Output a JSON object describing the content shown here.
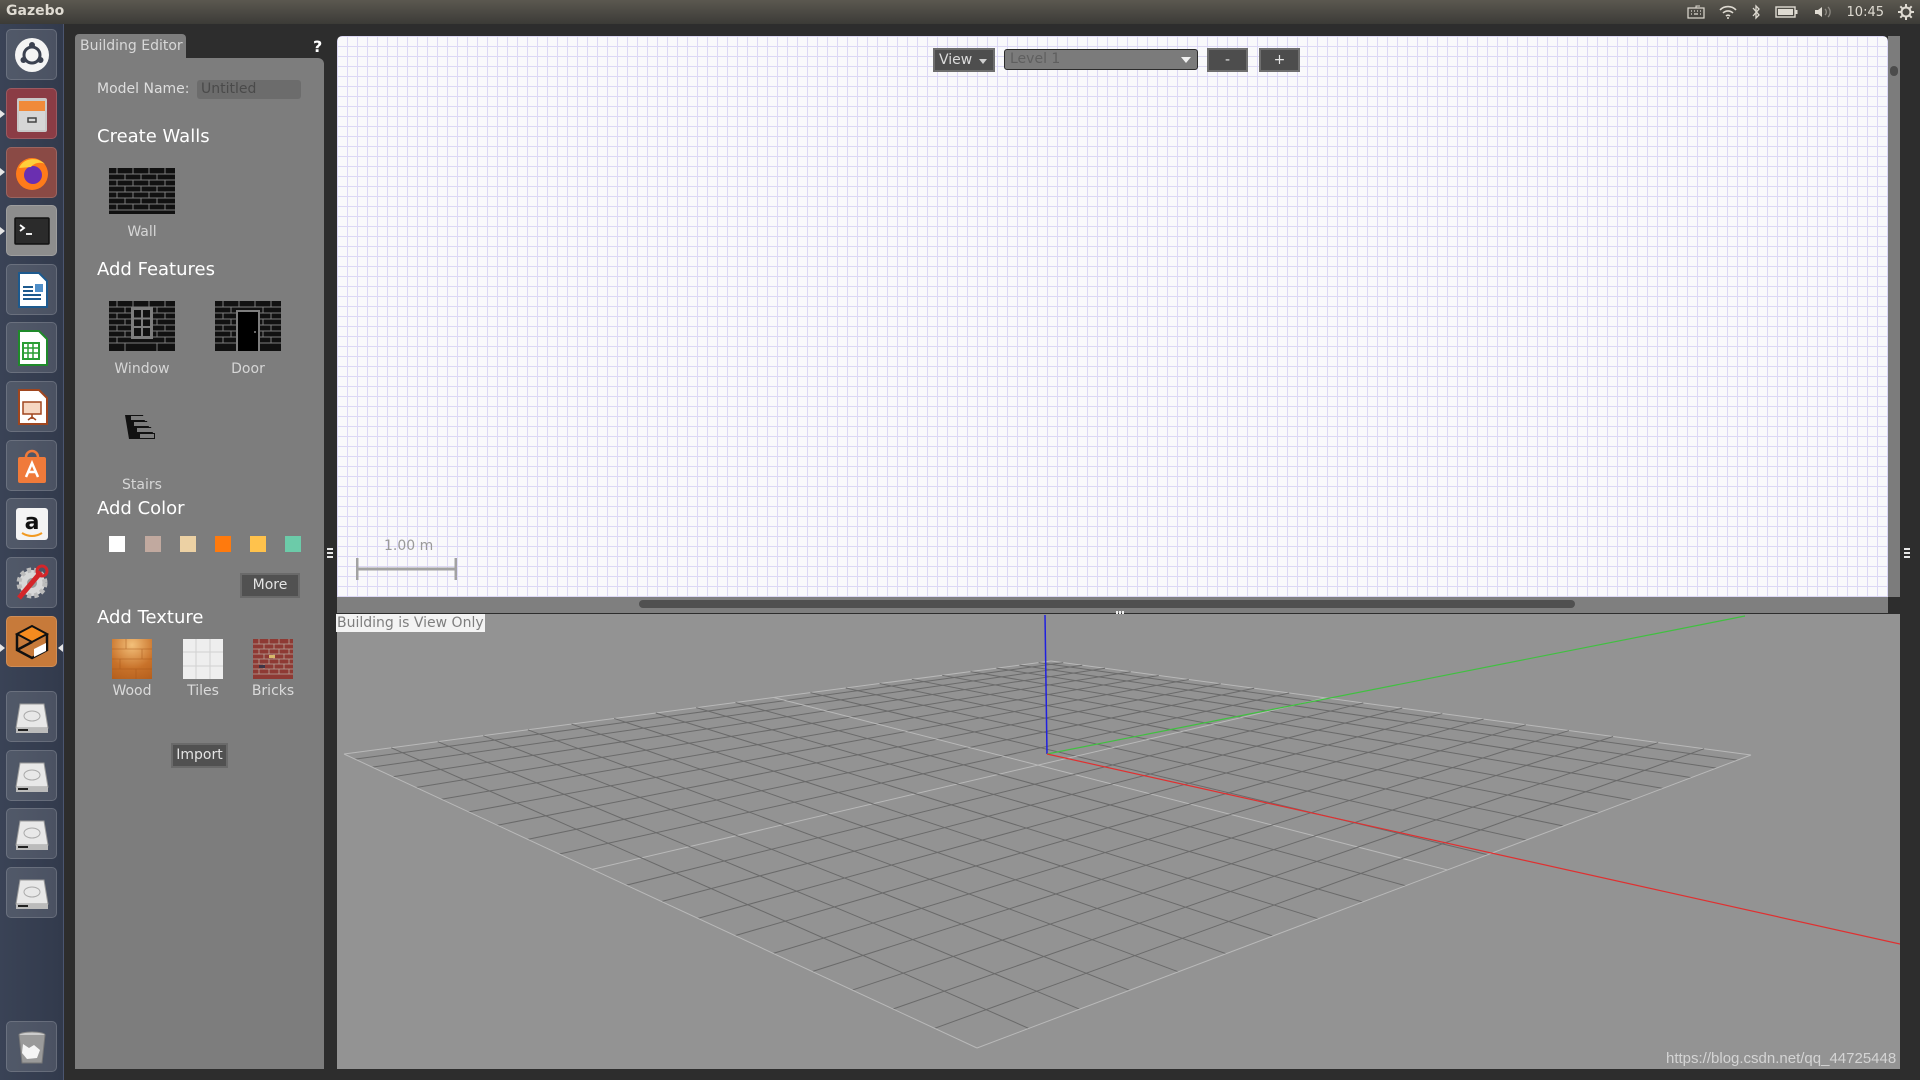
{
  "system": {
    "app_title": "Gazebo",
    "clock": "10:45",
    "tray_icons": [
      "keyboard-icon",
      "wifi-icon",
      "bluetooth-icon",
      "battery-icon",
      "volume-icon"
    ],
    "session_icon": "gear-icon"
  },
  "launcher": {
    "items": [
      {
        "name": "ubuntu-dash",
        "icon": "ubuntu-logo-icon"
      },
      {
        "name": "files",
        "icon": "file-cabinet-icon",
        "running": true
      },
      {
        "name": "firefox",
        "icon": "firefox-icon",
        "running": true
      },
      {
        "name": "terminal",
        "icon": "terminal-icon",
        "running": true
      },
      {
        "name": "libreoffice-writer",
        "icon": "writer-icon"
      },
      {
        "name": "libreoffice-calc",
        "icon": "calc-icon"
      },
      {
        "name": "libreoffice-impress",
        "icon": "impress-icon"
      },
      {
        "name": "ubuntu-software",
        "icon": "software-center-icon"
      },
      {
        "name": "amazon",
        "icon": "amazon-icon"
      },
      {
        "name": "system-settings",
        "icon": "settings-wrench-icon"
      },
      {
        "name": "gazebo",
        "icon": "gazebo-icon",
        "running": true,
        "focused": true
      },
      {
        "name": "drive-1",
        "icon": "hard-drive-icon"
      },
      {
        "name": "drive-2",
        "icon": "hard-drive-icon"
      },
      {
        "name": "drive-3",
        "icon": "hard-drive-icon"
      },
      {
        "name": "drive-4",
        "icon": "hard-drive-icon"
      },
      {
        "name": "trash",
        "icon": "trash-icon"
      }
    ]
  },
  "building_editor": {
    "tab_label": "Building Editor",
    "help_label": "?",
    "model_name_label": "Model Name:",
    "model_name_value": "Untitled",
    "sections": {
      "create_walls": "Create Walls",
      "add_features": "Add Features",
      "add_color": "Add Color",
      "add_texture": "Add Texture"
    },
    "tools": {
      "wall": "Wall",
      "window": "Window",
      "door": "Door",
      "stairs": "Stairs"
    },
    "colors": [
      "#ffffff",
      "#c1a99f",
      "#ecd1a4",
      "#ff7a0d",
      "#ffc24c",
      "#6ccba9"
    ],
    "more_label": "More",
    "textures": [
      {
        "label": "Wood",
        "icon": "wood-texture"
      },
      {
        "label": "Tiles",
        "icon": "tiles-texture"
      },
      {
        "label": "Bricks",
        "icon": "bricks-texture"
      }
    ],
    "import_label": "Import"
  },
  "editor_2d": {
    "view_label": "View",
    "level_value": "Level 1",
    "minus_label": "-",
    "plus_label": "+",
    "scale_label": "1.00 m"
  },
  "view_3d": {
    "status_label": "Building is View Only",
    "axis_colors": {
      "x": "#e03030",
      "y": "#40c040",
      "z": "#2020e0"
    }
  },
  "watermark": "https://blog.csdn.net/qq_44725448"
}
